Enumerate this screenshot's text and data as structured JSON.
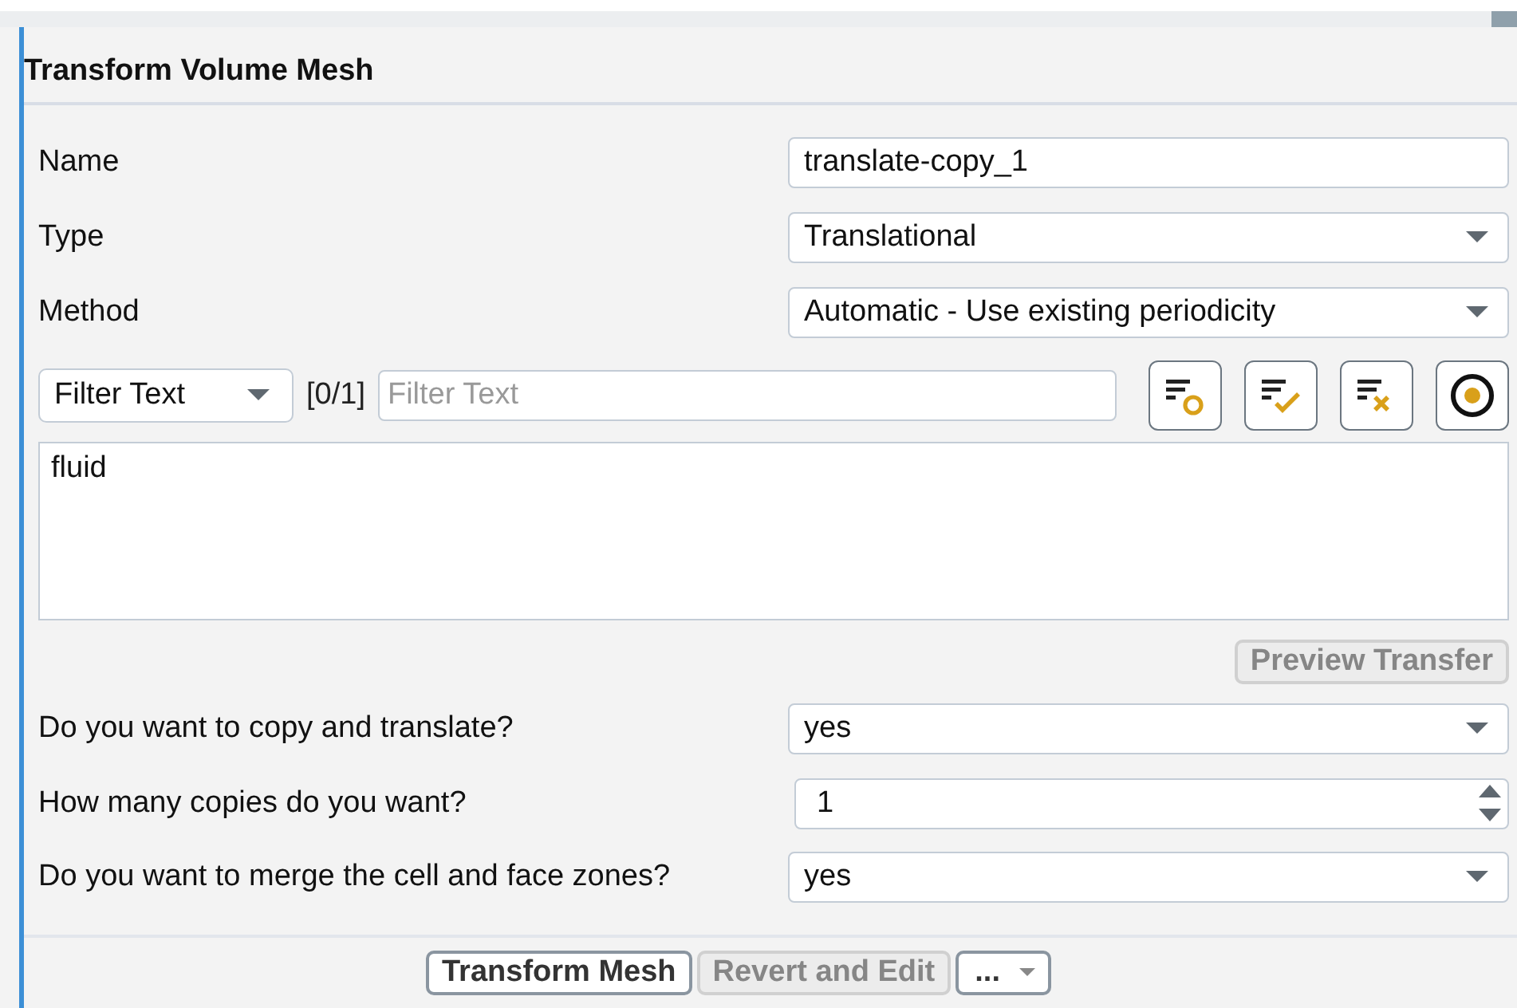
{
  "panel": {
    "title": "Transform Volume Mesh"
  },
  "fields": [
    {
      "label": "Name",
      "kind": "text",
      "value": "translate-copy_1"
    },
    {
      "label": "Type",
      "kind": "dropdown",
      "value": "Translational"
    },
    {
      "label": "Method",
      "kind": "dropdown",
      "value": "Automatic - Use existing periodicity"
    }
  ],
  "filter": {
    "mode": "Filter Text",
    "count": "[0/1]",
    "placeholder": "Filter Text"
  },
  "tool_buttons": [
    {
      "kind": "select-circle"
    },
    {
      "kind": "select-check"
    },
    {
      "kind": "select-clear"
    },
    {
      "kind": "radio"
    }
  ],
  "list_items": [
    "fluid"
  ],
  "preview_button": {
    "label": "Preview Transfer",
    "disabled": true
  },
  "questions": [
    {
      "label": "Do you want to copy and translate?",
      "kind": "dropdown",
      "value": "yes"
    },
    {
      "label": "How many copies do you want?",
      "kind": "spinner",
      "value": "1"
    },
    {
      "label": "Do you want to merge the cell and face zones?",
      "kind": "dropdown",
      "value": "yes"
    }
  ],
  "buttons": [
    {
      "label": "Transform Mesh",
      "kind": "button",
      "disabled": false
    },
    {
      "label": "Revert and Edit",
      "kind": "button",
      "disabled": true
    },
    {
      "label": "...",
      "kind": "menu",
      "disabled": false
    }
  ]
}
